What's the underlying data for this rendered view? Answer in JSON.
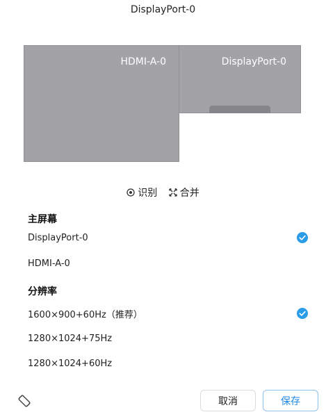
{
  "window": {
    "title": "DisplayPort-0"
  },
  "monitors": [
    {
      "id": "hdmi",
      "label": "HDMI-A-0"
    },
    {
      "id": "dp",
      "label": "DisplayPort-0"
    }
  ],
  "actions": {
    "identify_label": "识别",
    "merge_label": "合并"
  },
  "primary_screen": {
    "title": "主屏幕",
    "options": [
      {
        "label": "DisplayPort-0",
        "selected": true
      },
      {
        "label": "HDMI-A-0",
        "selected": false
      }
    ]
  },
  "resolution": {
    "title": "分辨率",
    "options": [
      {
        "label": "1600×900+60Hz（推荐）",
        "selected": true
      },
      {
        "label": "1280×1024+75Hz",
        "selected": false
      },
      {
        "label": "1280×1024+60Hz",
        "selected": false
      }
    ]
  },
  "footer": {
    "cancel_label": "取消",
    "save_label": "保存",
    "rotate_icon": "rotate-screen-icon"
  },
  "colors": {
    "accent": "#1e88e5",
    "check": "#2a9ce8",
    "monitor_fill": "#a3a2a7"
  }
}
